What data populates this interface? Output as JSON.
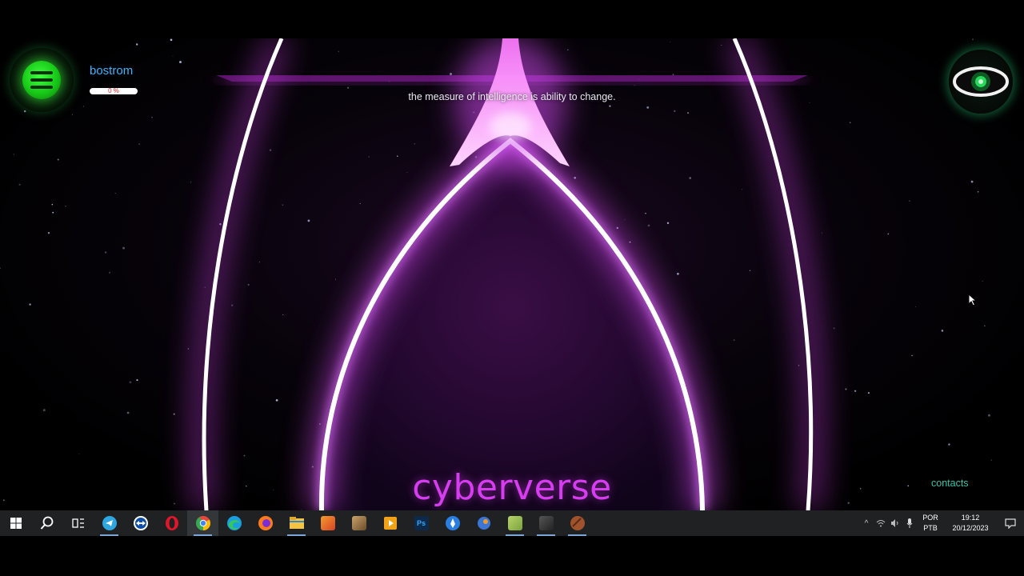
{
  "header": {
    "account_name": "bostrom",
    "progress_label": "0 %",
    "progress_value": 0
  },
  "hero": {
    "tagline": "the measure of intelligence is ability to change.",
    "brand": "cyberverse"
  },
  "footer": {
    "contacts_link": "contacts"
  },
  "icons": {
    "menu": "hamburger-menu-icon",
    "eye": "eye-icon"
  },
  "colors": {
    "accent_magenta": "#d63cf0",
    "menu_green": "#2ee02e",
    "account_blue": "#36b6ff",
    "contacts_teal": "#36c2a8"
  },
  "taskbar": {
    "apps": [
      "windows-start-icon",
      "search-icon",
      "task-view-icon",
      "telegram-icon",
      "teamviewer-icon",
      "opera-icon",
      "chrome-icon",
      "edge-icon",
      "firefox-icon",
      "file-explorer-icon",
      "app-icon",
      "app-icon",
      "media-player-icon",
      "photoshop-icon",
      "app-icon",
      "app-icon",
      "app-icon",
      "app-icon",
      "app-icon"
    ],
    "photoshop_label": "Ps",
    "tray": {
      "lang_top": "POR",
      "lang_bottom": "PTB",
      "time": "19:12",
      "date": "20/12/2023"
    }
  }
}
